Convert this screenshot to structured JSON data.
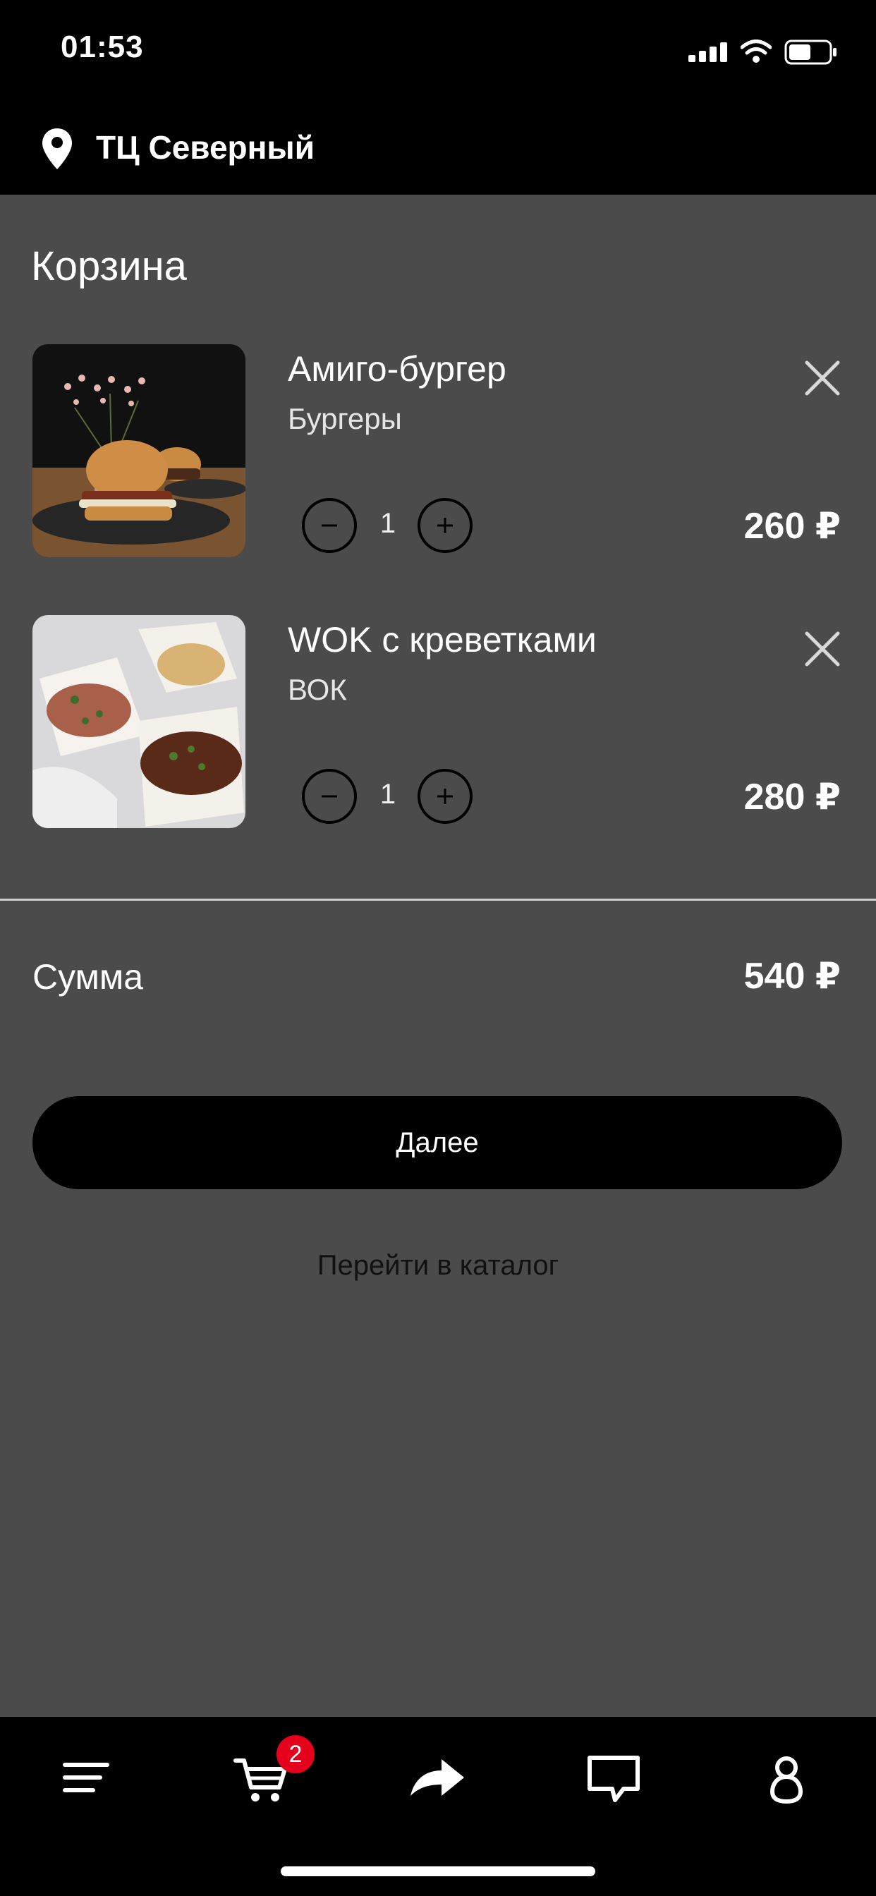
{
  "status_bar": {
    "time": "01:53"
  },
  "location": {
    "name": "ТЦ Северный",
    "icon": "map-pin-icon"
  },
  "cart": {
    "title": "Корзина",
    "items": [
      {
        "name": "Амиго-бургер",
        "category": "Бургеры",
        "quantity": "1",
        "price": "260 ₽"
      },
      {
        "name": "WOK с креветками",
        "category": "ВОК",
        "quantity": "1",
        "price": "280 ₽"
      }
    ],
    "total_label": "Сумма",
    "total_value": "540 ₽",
    "next_label": "Далее",
    "catalog_link": "Перейти в каталог"
  },
  "tab_bar": {
    "cart_badge": "2",
    "tabs": [
      "menu-icon",
      "cart-icon",
      "share-icon",
      "chat-icon",
      "profile-icon"
    ]
  },
  "colors": {
    "background": "#4b4b4b",
    "bars": "#000000",
    "badge": "#e5001c",
    "text": "#ffffff"
  }
}
